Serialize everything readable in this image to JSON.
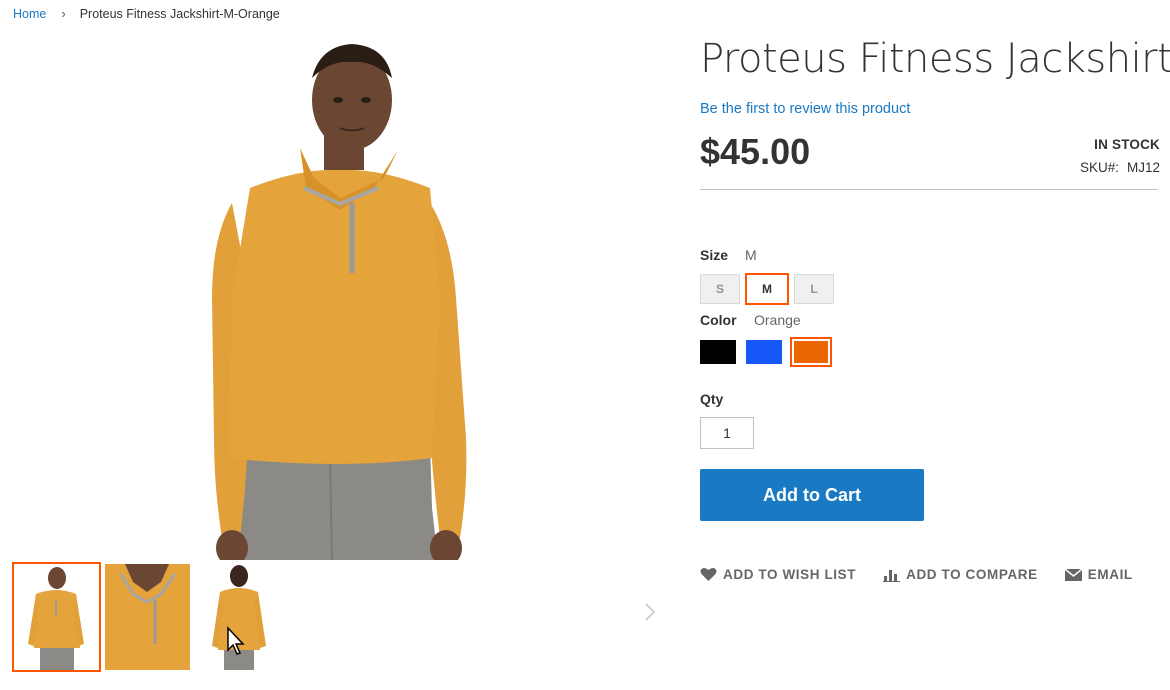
{
  "breadcrumb": {
    "home": "Home",
    "separator": "›",
    "current": "Proteus Fitness Jackshirt-M-Orange"
  },
  "product": {
    "title": "Proteus Fitness Jackshirt",
    "review_link": "Be the first to review this product",
    "price": "$45.00",
    "stock": "IN STOCK",
    "sku_label": "SKU#:",
    "sku": "MJ12"
  },
  "options": {
    "size_label": "Size",
    "size_selected": "M",
    "sizes": [
      "S",
      "M",
      "L"
    ],
    "color_label": "Color",
    "color_selected": "Orange",
    "colors": [
      {
        "name": "Black",
        "hex": "#000000"
      },
      {
        "name": "Blue",
        "hex": "#1857f7"
      },
      {
        "name": "Orange",
        "hex": "#eb6703"
      }
    ]
  },
  "qty": {
    "label": "Qty",
    "value": "1"
  },
  "cart": {
    "add_label": "Add to Cart"
  },
  "actions": {
    "wishlist": "ADD TO WISH LIST",
    "compare": "ADD TO COMPARE",
    "email": "EMAIL"
  },
  "theme": {
    "link_color": "#1979c3",
    "accent_selected": "#ff5501",
    "button_color": "#1979c3"
  }
}
